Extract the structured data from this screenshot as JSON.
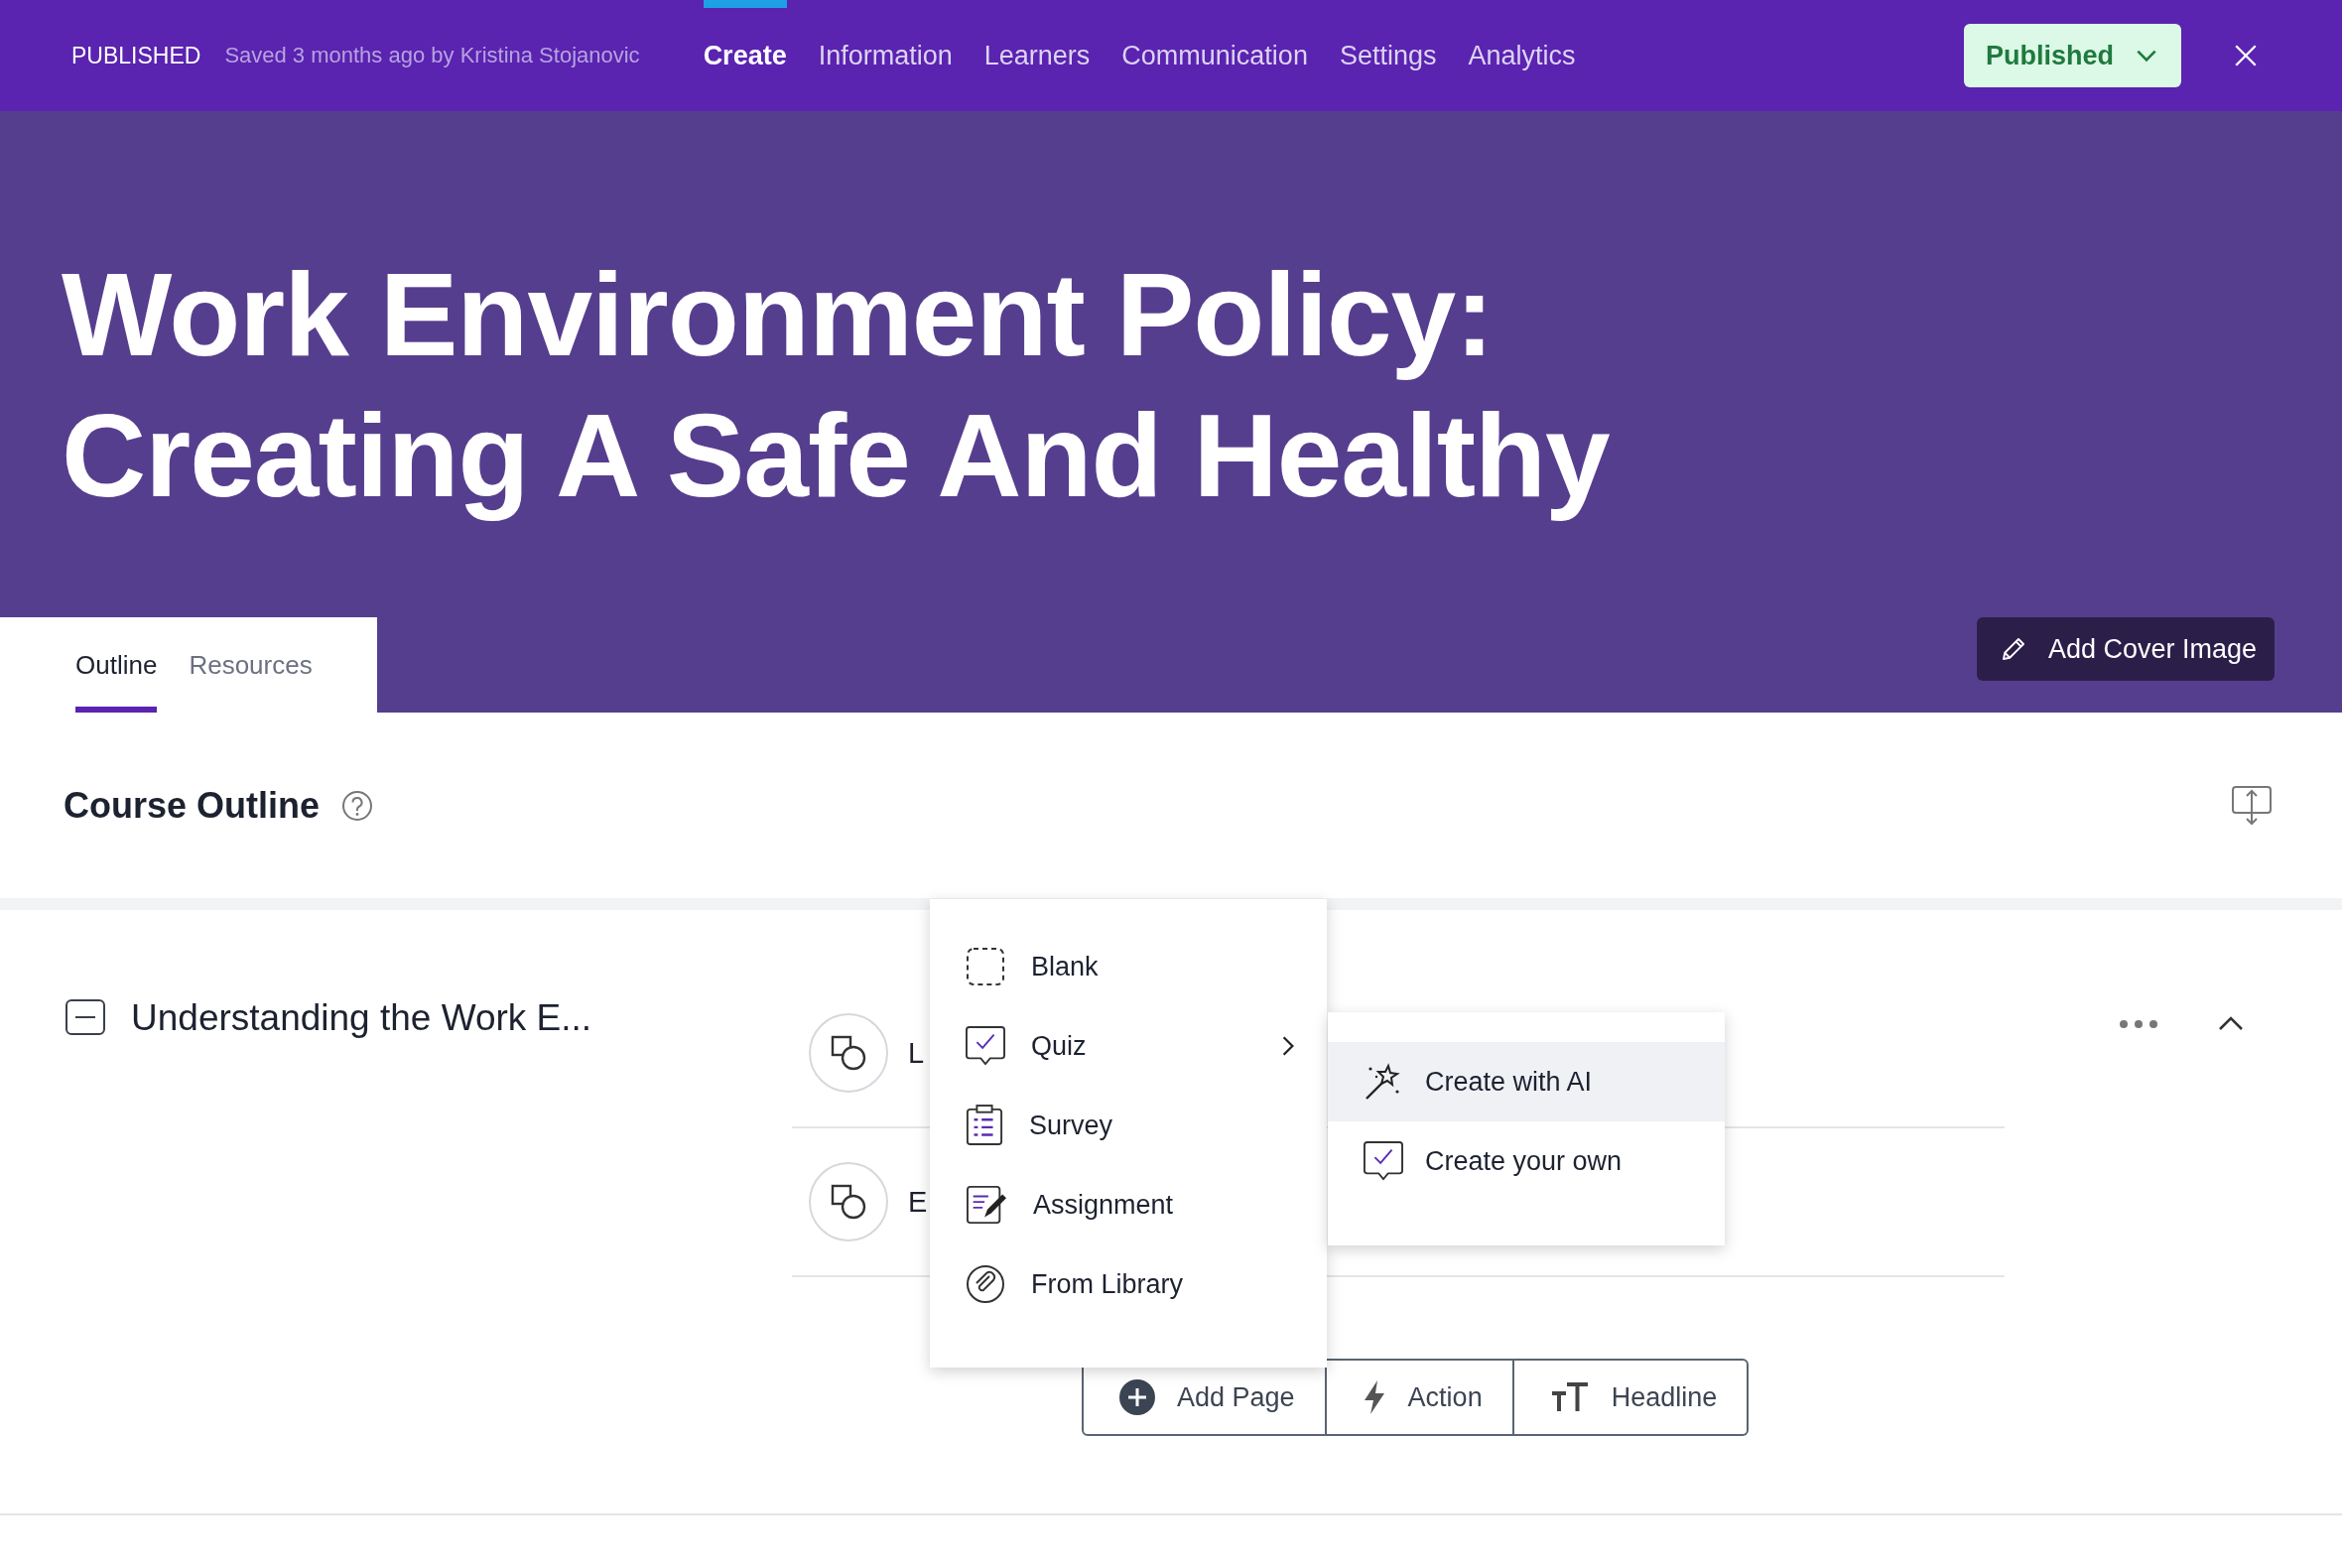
{
  "header": {
    "status": "PUBLISHED",
    "saved_note": "Saved 3 months ago by Kristina Stojanovic",
    "nav": [
      {
        "label": "Create",
        "selected": true
      },
      {
        "label": "Information",
        "selected": false
      },
      {
        "label": "Learners",
        "selected": false
      },
      {
        "label": "Communication",
        "selected": false
      },
      {
        "label": "Settings",
        "selected": false
      },
      {
        "label": "Analytics",
        "selected": false
      }
    ],
    "publish_button": "Published"
  },
  "hero": {
    "title_lines": [
      "Work Environment Policy:",
      "Creating A Safe And Healthy"
    ],
    "tabs": [
      {
        "label": "Outline",
        "selected": true
      },
      {
        "label": "Resources",
        "selected": false
      }
    ],
    "cover_button": "Add Cover Image"
  },
  "outline": {
    "title": "Course Outline",
    "section": {
      "title": "Understanding the Work E...",
      "expanded": true,
      "pages": [
        {
          "title": "L"
        },
        {
          "title": "E"
        }
      ]
    }
  },
  "add_menu": [
    {
      "kind": "blank",
      "label": "Blank",
      "has_submenu": false
    },
    {
      "kind": "quiz",
      "label": "Quiz",
      "has_submenu": true
    },
    {
      "kind": "survey",
      "label": "Survey",
      "has_submenu": false
    },
    {
      "kind": "assignment",
      "label": "Assignment",
      "has_submenu": false
    },
    {
      "kind": "library",
      "label": "From Library",
      "has_submenu": false
    }
  ],
  "submenu": [
    {
      "kind": "ai",
      "label": "Create with AI",
      "selected": true
    },
    {
      "kind": "own",
      "label": "Create your own",
      "selected": false
    }
  ],
  "add_bar": [
    {
      "kind": "page",
      "label": "Add Page"
    },
    {
      "kind": "action",
      "label": "Action"
    },
    {
      "kind": "headline",
      "label": "Headline"
    }
  ]
}
